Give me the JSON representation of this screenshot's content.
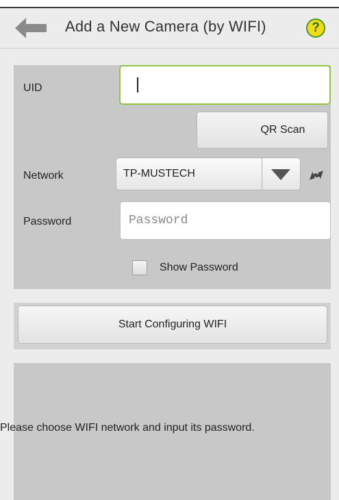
{
  "header": {
    "title": "Add a New Camera (by WIFI)",
    "back_icon": "back-arrow-icon",
    "help_symbol": "?",
    "help_icon": "help-icon",
    "accent": "#8ec640",
    "help_fill": "#f3da1a"
  },
  "form": {
    "uid_label": "UID",
    "uid_value": "",
    "qr_button_label": "QR Scan",
    "network_label": "Network",
    "network_value": "TP-MUSTECH",
    "password_label": "Password",
    "password_placeholder": "Password",
    "password_value": "",
    "show_password_label": "Show Password",
    "show_password_checked": false
  },
  "actions": {
    "start_button_label": "Start Configuring WIFI"
  },
  "info": {
    "message": "Please choose WIFI network and input its password."
  }
}
